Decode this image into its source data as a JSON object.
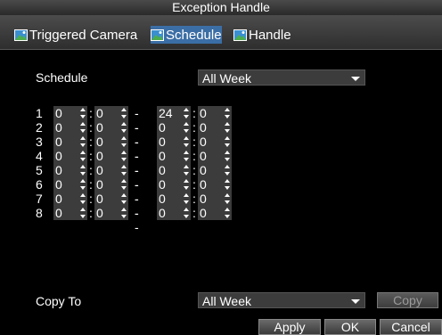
{
  "window": {
    "title": "Exception Handle"
  },
  "tabs": [
    {
      "label": "Triggered Camera",
      "active": false
    },
    {
      "label": "Schedule",
      "active": true
    },
    {
      "label": "Handle",
      "active": false
    }
  ],
  "schedule": {
    "label": "Schedule",
    "value": "All Week"
  },
  "rows": [
    {
      "n": "1",
      "sh": "0",
      "sm": "0",
      "eh": "24",
      "em": "0"
    },
    {
      "n": "2",
      "sh": "0",
      "sm": "0",
      "eh": "0",
      "em": "0"
    },
    {
      "n": "3",
      "sh": "0",
      "sm": "0",
      "eh": "0",
      "em": "0"
    },
    {
      "n": "4",
      "sh": "0",
      "sm": "0",
      "eh": "0",
      "em": "0"
    },
    {
      "n": "5",
      "sh": "0",
      "sm": "0",
      "eh": "0",
      "em": "0"
    },
    {
      "n": "6",
      "sh": "0",
      "sm": "0",
      "eh": "0",
      "em": "0"
    },
    {
      "n": "7",
      "sh": "0",
      "sm": "0",
      "eh": "0",
      "em": "0"
    },
    {
      "n": "8",
      "sh": "0",
      "sm": "0",
      "eh": "0",
      "em": "0"
    }
  ],
  "separators": {
    "colon": ":",
    "dash": "--"
  },
  "copy_to": {
    "label": "Copy To",
    "value": "All Week",
    "button": "Copy"
  },
  "buttons": {
    "apply": "Apply",
    "ok": "OK",
    "cancel": "Cancel"
  },
  "colors": {
    "active_tab": "#3b6ea5",
    "field_bg": "#3c3c3c",
    "background": "#000000"
  },
  "icons": {
    "tab_icon": "landscape-picture-icon"
  }
}
